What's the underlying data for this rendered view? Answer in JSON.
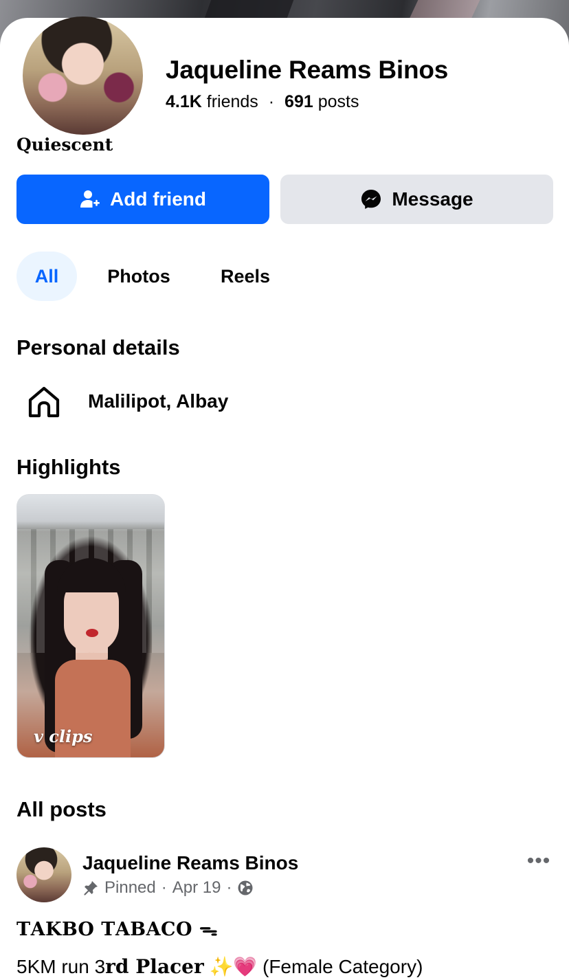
{
  "profile": {
    "name": "Jaqueline Reams Binos",
    "friends_count": "4.1K",
    "friends_label": "friends",
    "posts_count": "691",
    "posts_label": "posts",
    "bio": "Quiescent"
  },
  "actions": {
    "add_friend": "Add friend",
    "message": "Message"
  },
  "tabs": [
    {
      "label": "All",
      "selected": true
    },
    {
      "label": "Photos",
      "selected": false
    },
    {
      "label": "Reels",
      "selected": false
    }
  ],
  "personal_details": {
    "title": "Personal details",
    "location": "Malilipot, Albay",
    "location_icon": "home-icon"
  },
  "highlights": {
    "title": "Highlights",
    "items": [
      {
        "caption": "v clips"
      }
    ]
  },
  "posts": {
    "title": "All posts",
    "items": [
      {
        "author": "Jaqueline Reams Binos",
        "pinned_label": "Pinned",
        "date": "Apr 19",
        "audience_icon": "globe-icon",
        "line1": "𝐓𝐀𝐊𝐁𝐎 𝐓𝐀𝐁𝐀𝐂𝐎",
        "line1_emoji": "ᯓ",
        "line2_prefix": "5KM run 3",
        "line2_bold": "𝐫𝐝 𝐏𝐥𝐚𝐜𝐞𝐫",
        "line2_emoji": "✨💗",
        "line2_suffix": "(Female Category)"
      }
    ]
  },
  "colors": {
    "accent": "#0866ff",
    "tab_selected_bg": "#ebf5ff",
    "secondary_button_bg": "#e4e6eb",
    "muted_text": "#65676b"
  }
}
